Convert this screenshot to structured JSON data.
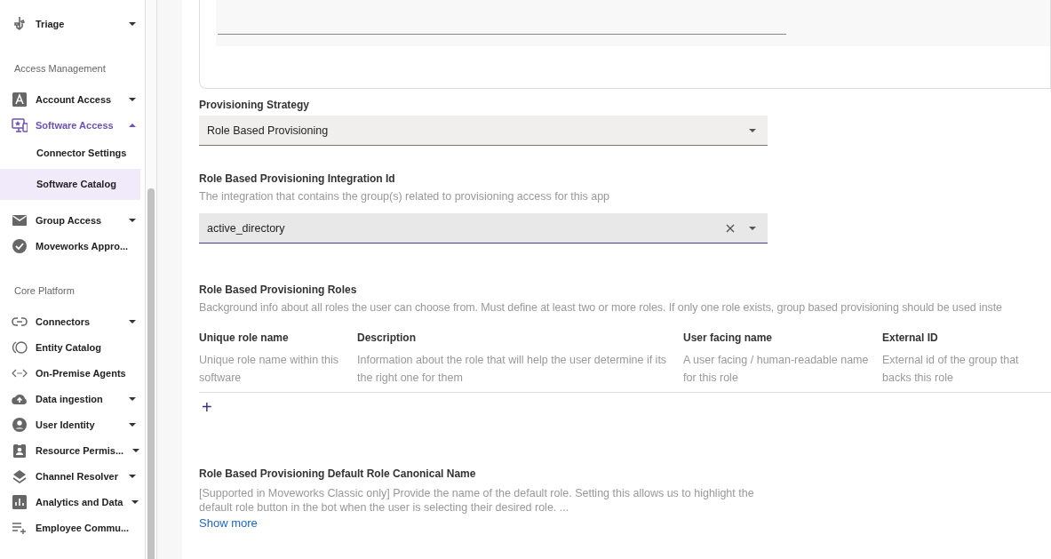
{
  "sidebar": {
    "sections": [
      {
        "items": [
          {
            "label": "Triage",
            "expanded": false,
            "selected": false
          }
        ]
      },
      {
        "title": "Access Management",
        "items": [
          {
            "label": "Account Access",
            "expanded": false,
            "selected": false
          },
          {
            "label": "Software Access",
            "expanded": true,
            "selected": true,
            "children": [
              {
                "label": "Connector Settings",
                "selected": false
              },
              {
                "label": "Software Catalog",
                "selected": true
              }
            ]
          },
          {
            "label": "Group Access",
            "expanded": false,
            "selected": false
          },
          {
            "label": "Moveworks Appro...",
            "selected": false
          }
        ]
      },
      {
        "title": "Core Platform",
        "items": [
          {
            "label": "Connectors",
            "expanded": false,
            "selected": false
          },
          {
            "label": "Entity Catalog",
            "selected": false
          },
          {
            "label": "On-Premise Agents",
            "selected": false
          },
          {
            "label": "Data ingestion",
            "expanded": false,
            "selected": false
          },
          {
            "label": "User Identity",
            "expanded": false,
            "selected": false
          },
          {
            "label": "Resource Permis...",
            "expanded": false,
            "selected": false
          },
          {
            "label": "Channel Resolver",
            "expanded": false,
            "selected": false
          },
          {
            "label": "Analytics and Data",
            "expanded": false,
            "selected": false
          },
          {
            "label": "Employee Commu...",
            "selected": false
          }
        ]
      }
    ]
  },
  "form": {
    "strategy": {
      "label": "Provisioning Strategy",
      "value": "Role Based Provisioning"
    },
    "integration": {
      "label": "Role Based Provisioning Integration Id",
      "help": "The integration that contains the group(s) related to provisioning access for this app",
      "value": "active_directory",
      "clearable": true
    },
    "roles": {
      "label": "Role Based Provisioning Roles",
      "help": "Background info about all roles the user can choose from. Must define at least two or more roles. If only one role exists, group based provisioning should be used inste",
      "columns": [
        {
          "name": "Unique role name",
          "hint": "Unique role name within this software"
        },
        {
          "name": "Description",
          "hint": "Information about the role that will help the user determine if its the right one for them"
        },
        {
          "name": "User facing name",
          "hint": "A user facing / human-readable name for this role"
        },
        {
          "name": "External ID",
          "hint": "External id of the group that backs this role"
        }
      ],
      "add": "+"
    },
    "default_role": {
      "label": "Role Based Provisioning Default Role Canonical Name",
      "help": "[Supported in Moveworks Classic only] Provide the name of the default role. Setting this allows us to highlight the default role button in the bot when the user is selecting their desired role. ...",
      "more": "Show more"
    }
  }
}
